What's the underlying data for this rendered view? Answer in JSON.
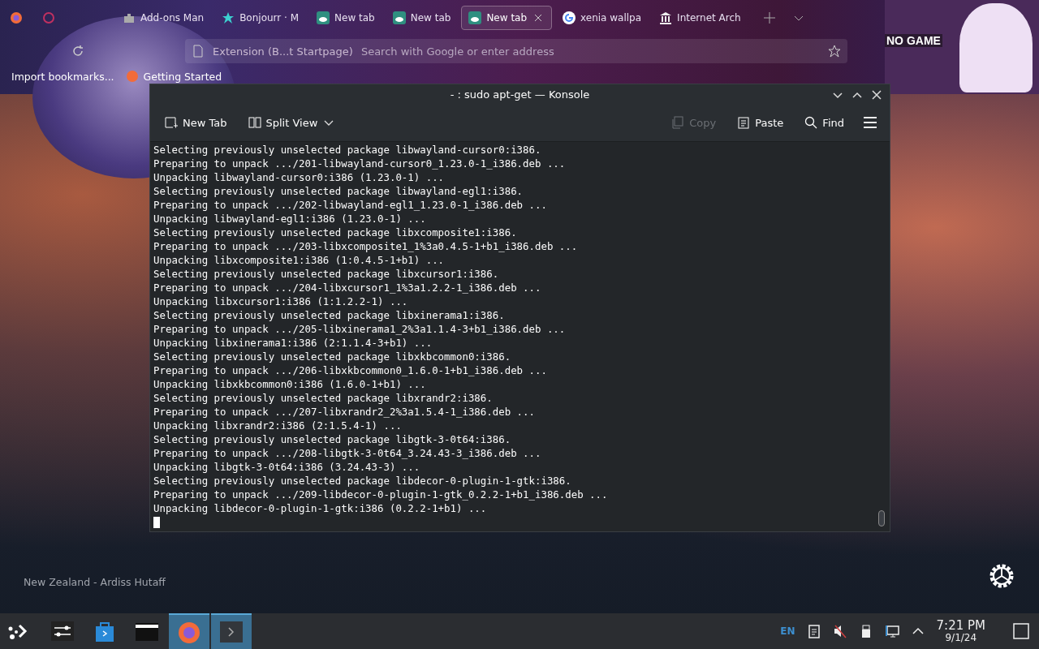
{
  "browser": {
    "tabs": [
      {
        "label": "Add-ons Man",
        "selected": false,
        "kind": "puzzle"
      },
      {
        "label": "Bonjourr · M",
        "selected": false,
        "kind": "star"
      },
      {
        "label": "New tab",
        "selected": false,
        "kind": "tile"
      },
      {
        "label": "New tab",
        "selected": false,
        "kind": "tile"
      },
      {
        "label": "New tab",
        "selected": true,
        "kind": "tile"
      },
      {
        "label": "xenia wallpa",
        "selected": false,
        "kind": "g"
      },
      {
        "label": "Internet Arch",
        "selected": false,
        "kind": "museum"
      }
    ],
    "address": "Extension (B...t Startpage)",
    "search_placeholder": "Search with Google or enter address",
    "bookmarks": [
      "Import bookmarks...",
      "Getting Started"
    ],
    "banner": {
      "title": "NO GAME"
    }
  },
  "konsole": {
    "title": "- : sudo apt-get — Konsole",
    "toolbar": [
      {
        "label": "New Tab",
        "kind": "newtab",
        "disabled": false
      },
      {
        "label": "Split View",
        "kind": "split",
        "disabled": false
      },
      {
        "label": "Copy",
        "kind": "copy",
        "disabled": true
      },
      {
        "label": "Paste",
        "kind": "paste",
        "disabled": false
      },
      {
        "label": "Find",
        "kind": "find",
        "disabled": false
      }
    ],
    "lines": [
      "Selecting previously unselected package libwayland-cursor0:i386.",
      "Preparing to unpack .../201-libwayland-cursor0_1.23.0-1_i386.deb ...",
      "Unpacking libwayland-cursor0:i386 (1.23.0-1) ...",
      "Selecting previously unselected package libwayland-egl1:i386.",
      "Preparing to unpack .../202-libwayland-egl1_1.23.0-1_i386.deb ...",
      "Unpacking libwayland-egl1:i386 (1.23.0-1) ...",
      "Selecting previously unselected package libxcomposite1:i386.",
      "Preparing to unpack .../203-libxcomposite1_1%3a0.4.5-1+b1_i386.deb ...",
      "Unpacking libxcomposite1:i386 (1:0.4.5-1+b1) ...",
      "Selecting previously unselected package libxcursor1:i386.",
      "Preparing to unpack .../204-libxcursor1_1%3a1.2.2-1_i386.deb ...",
      "Unpacking libxcursor1:i386 (1:1.2.2-1) ...",
      "Selecting previously unselected package libxinerama1:i386.",
      "Preparing to unpack .../205-libxinerama1_2%3a1.1.4-3+b1_i386.deb ...",
      "Unpacking libxinerama1:i386 (2:1.1.4-3+b1) ...",
      "Selecting previously unselected package libxkbcommon0:i386.",
      "Preparing to unpack .../206-libxkbcommon0_1.6.0-1+b1_i386.deb ...",
      "Unpacking libxkbcommon0:i386 (1.6.0-1+b1) ...",
      "Selecting previously unselected package libxrandr2:i386.",
      "Preparing to unpack .../207-libxrandr2_2%3a1.5.4-1_i386.deb ...",
      "Unpacking libxrandr2:i386 (2:1.5.4-1) ...",
      "Selecting previously unselected package libgtk-3-0t64:i386.",
      "Preparing to unpack .../208-libgtk-3-0t64_3.24.43-3_i386.deb ...",
      "Unpacking libgtk-3-0t64:i386 (3.24.43-3) ...",
      "Selecting previously unselected package libdecor-0-plugin-1-gtk:i386.",
      "Preparing to unpack .../209-libdecor-0-plugin-1-gtk_0.2.2-1+b1_i386.deb ...",
      "Unpacking libdecor-0-plugin-1-gtk:i386 (0.2.2-1+b1) ..."
    ]
  },
  "wallpaper_credit": "New Zealand - Ardiss Hutaff",
  "taskbar": {
    "apps": [
      {
        "kind": "settings",
        "selected": false
      },
      {
        "kind": "store",
        "selected": false
      },
      {
        "kind": "files",
        "selected": false
      },
      {
        "kind": "firefox",
        "selected": true
      },
      {
        "kind": "terminal",
        "selected": true
      }
    ],
    "language": "EN",
    "time": "7:21 PM",
    "date": "9/1/24"
  }
}
